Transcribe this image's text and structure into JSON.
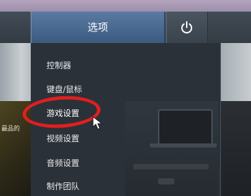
{
  "header": {
    "tab_label": "选项",
    "power_button_icon": "power-icon"
  },
  "menu": {
    "items": [
      {
        "label": "控制器"
      },
      {
        "label": "键盘/鼠标"
      },
      {
        "label": "游戏设置"
      },
      {
        "label": "视频设置"
      },
      {
        "label": "音频设置"
      },
      {
        "label": "制作团队"
      }
    ],
    "highlighted_item": "游戏设置"
  },
  "background": {
    "left_text_fragment": "最品的"
  },
  "annotation": {
    "color": "#e01f1f",
    "target": "游戏设置"
  },
  "colors": {
    "tab_active": "#4a6a93",
    "menu_panel": "#2b3138",
    "menu_text": "#e8eaec"
  }
}
